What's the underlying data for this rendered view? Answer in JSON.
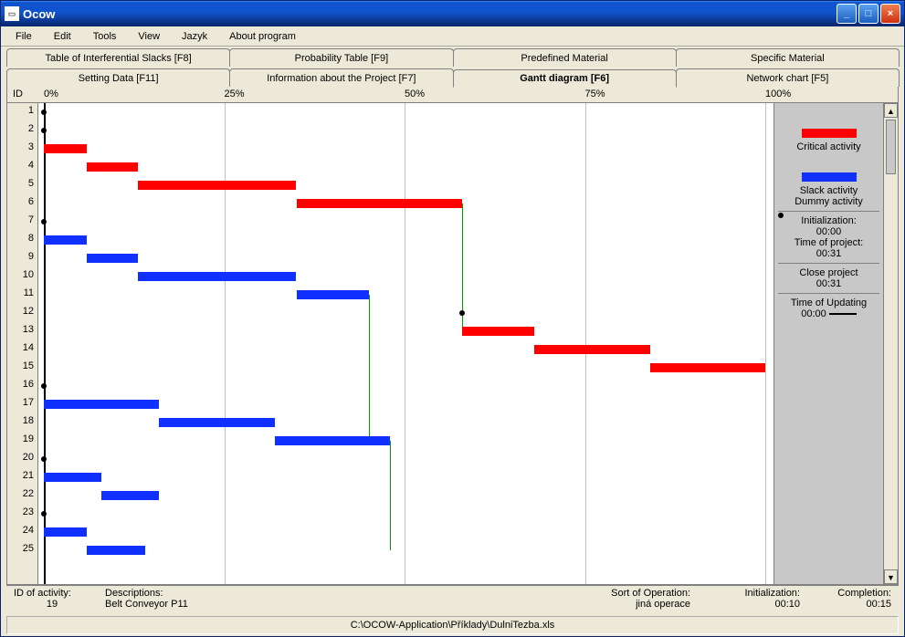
{
  "window": {
    "title": "Ocow"
  },
  "menu": [
    "File",
    "Edit",
    "Tools",
    "View",
    "Jazyk",
    "About program"
  ],
  "tabs_row1": [
    "Table of Interferential Slacks [F8]",
    "Probability Table  [F9]",
    "Predefined Material",
    "Specific Material"
  ],
  "tabs_row2": [
    "Setting Data  [F11]",
    "Information about the Project  [F7]",
    "Gantt diagram   [F6]",
    "Network chart  [F5]"
  ],
  "active_tab": "Gantt diagram   [F6]",
  "axis": {
    "id_label": "ID",
    "ticks": [
      {
        "label": "0%",
        "pct": 0
      },
      {
        "label": "25%",
        "pct": 25
      },
      {
        "label": "50%",
        "pct": 50
      },
      {
        "label": "75%",
        "pct": 75
      },
      {
        "label": "100%",
        "pct": 100
      }
    ]
  },
  "legend": {
    "crit": "Critical activity",
    "slack": "Slack activity",
    "dummy": "Dummy activity",
    "init_lbl": "Initialization:",
    "init_val": "00:00",
    "top_lbl": "Time of project:",
    "top_val": "00:31",
    "close_lbl": "Close project",
    "close_val": "00:31",
    "upd_lbl": "Time of Updating",
    "upd_val": "00:00"
  },
  "status": {
    "id_lbl": "ID of activity:",
    "id_val": "19",
    "desc_lbl": "Descriptions:",
    "desc_val": "Belt Conveyor P11",
    "sort_lbl": "Sort of Operation:",
    "sort_val": "jiná operace",
    "init_lbl": "Initialization:",
    "init_val": "00:10",
    "compl_lbl": "Completion:",
    "compl_val": "00:15"
  },
  "statusbar": "C:\\OCOW-Application\\Příklady\\DulniTezba.xls",
  "chart_data": {
    "type": "gantt",
    "x_range": [
      0,
      100
    ],
    "rows": [
      1,
      2,
      3,
      4,
      5,
      6,
      7,
      8,
      9,
      10,
      11,
      12,
      13,
      14,
      15,
      16,
      17,
      18,
      19,
      20,
      21,
      22,
      23,
      24,
      25
    ],
    "bars": [
      {
        "row": 3,
        "start": 0,
        "end": 6,
        "kind": "red"
      },
      {
        "row": 4,
        "start": 6,
        "end": 13,
        "kind": "red"
      },
      {
        "row": 5,
        "start": 13,
        "end": 35,
        "kind": "red"
      },
      {
        "row": 6,
        "start": 35,
        "end": 58,
        "kind": "red"
      },
      {
        "row": 8,
        "start": 0,
        "end": 6,
        "kind": "blue"
      },
      {
        "row": 9,
        "start": 6,
        "end": 13,
        "kind": "blue"
      },
      {
        "row": 10,
        "start": 13,
        "end": 35,
        "kind": "blue"
      },
      {
        "row": 11,
        "start": 35,
        "end": 45,
        "kind": "blue"
      },
      {
        "row": 13,
        "start": 58,
        "end": 68,
        "kind": "red"
      },
      {
        "row": 14,
        "start": 68,
        "end": 84,
        "kind": "red"
      },
      {
        "row": 15,
        "start": 84,
        "end": 100,
        "kind": "red"
      },
      {
        "row": 17,
        "start": 0,
        "end": 16,
        "kind": "blue"
      },
      {
        "row": 18,
        "start": 16,
        "end": 32,
        "kind": "blue"
      },
      {
        "row": 19,
        "start": 32,
        "end": 48,
        "kind": "blue"
      },
      {
        "row": 21,
        "start": 0,
        "end": 8,
        "kind": "blue"
      },
      {
        "row": 22,
        "start": 8,
        "end": 16,
        "kind": "blue"
      },
      {
        "row": 24,
        "start": 0,
        "end": 6,
        "kind": "blue"
      },
      {
        "row": 25,
        "start": 6,
        "end": 14,
        "kind": "blue"
      }
    ],
    "dummies": [
      {
        "row": 1,
        "x": 0
      },
      {
        "row": 2,
        "x": 0
      },
      {
        "row": 7,
        "x": 0
      },
      {
        "row": 12,
        "x": 58
      },
      {
        "row": 16,
        "x": 0
      },
      {
        "row": 20,
        "x": 0
      },
      {
        "row": 23,
        "x": 0
      }
    ],
    "green_v": [
      {
        "x": 58,
        "top_row": 6,
        "bot_row": 13
      },
      {
        "x": 45,
        "top_row": 11,
        "bot_row": 19
      },
      {
        "x": 48,
        "top_row": 19,
        "bot_row": 25
      }
    ]
  }
}
